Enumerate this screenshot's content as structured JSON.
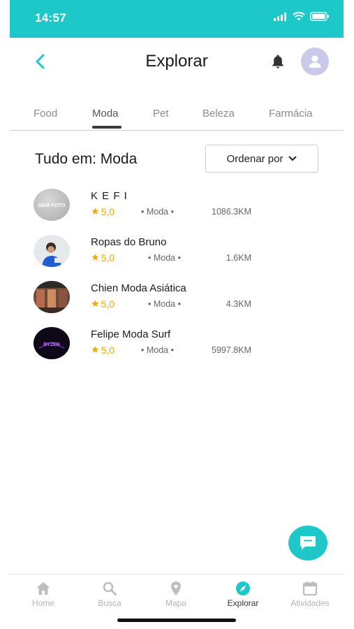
{
  "status_bar": {
    "time": "14:57"
  },
  "header": {
    "title": "Explorar"
  },
  "tabs": [
    {
      "label": "Food"
    },
    {
      "label": "Moda"
    },
    {
      "label": "Pet"
    },
    {
      "label": "Beleza"
    },
    {
      "label": "Farmácia"
    }
  ],
  "active_tab": "Moda",
  "section": {
    "title": "Tudo em: Moda",
    "sort_label": "Ordenar por"
  },
  "stores": [
    {
      "name": "K E F I",
      "rating": "5,0",
      "category": "• Moda •",
      "distance": "1086.3KM",
      "logo_text": "SEM FOTO"
    },
    {
      "name": "Ropas do Bruno",
      "rating": "5,0",
      "category": "• Moda •",
      "distance": "1.6KM"
    },
    {
      "name": "Chien Moda Asiática",
      "rating": "5,0",
      "category": "• Moda •",
      "distance": "4.3KM"
    },
    {
      "name": "Felipe Moda Surf",
      "rating": "5,0",
      "category": "• Moda •",
      "distance": "5997.8KM",
      "logo_text": "RYZEN"
    }
  ],
  "bottom_nav": [
    {
      "label": "Home",
      "icon": "home-icon"
    },
    {
      "label": "Busca",
      "icon": "search-icon"
    },
    {
      "label": "Mapa",
      "icon": "map-pin-icon"
    },
    {
      "label": "Explorar",
      "icon": "compass-icon"
    },
    {
      "label": "Atividades",
      "icon": "calendar-icon"
    }
  ],
  "colors": {
    "accent": "#1ec8c8",
    "rating": "#f0a800",
    "avatar_bg": "#c9c9ea"
  }
}
